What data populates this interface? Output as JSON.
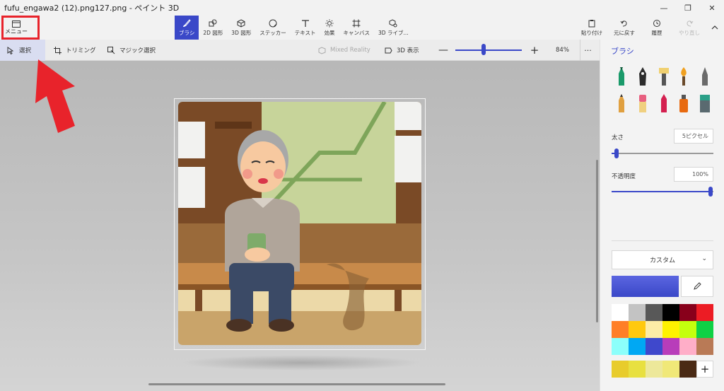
{
  "window": {
    "title": "fufu_engawa2 (12).png127.png - ペイント 3D",
    "minimize": "—",
    "maximize": "❐",
    "close": "✕"
  },
  "toolbar": {
    "menu_label": "メニュー",
    "tools": [
      {
        "label": "ブラシ",
        "icon": "brush-icon",
        "active": true
      },
      {
        "label": "2D 図形",
        "icon": "2d-shapes-icon",
        "active": false
      },
      {
        "label": "3D 図形",
        "icon": "3d-shapes-icon",
        "active": false
      },
      {
        "label": "ステッカー",
        "icon": "sticker-icon",
        "active": false
      },
      {
        "label": "テキスト",
        "icon": "text-icon",
        "active": false
      },
      {
        "label": "効果",
        "icon": "effects-icon",
        "active": false
      },
      {
        "label": "キャンバス",
        "icon": "canvas-icon",
        "active": false
      },
      {
        "label": "3D ライブ...",
        "icon": "3d-library-icon",
        "active": false
      }
    ],
    "right_tools": [
      {
        "label": "貼り付け",
        "icon": "paste-icon",
        "disabled": false
      },
      {
        "label": "元に戻す",
        "icon": "undo-icon",
        "disabled": false
      },
      {
        "label": "履歴",
        "icon": "history-icon",
        "disabled": false
      },
      {
        "label": "やり直し",
        "icon": "redo-icon",
        "disabled": true
      }
    ],
    "collapse_icon": "chevron-up-icon"
  },
  "subbar": {
    "select_label": "選択",
    "crop_label": "トリミング",
    "magic_select_label": "マジック選択",
    "mixed_reality_label": "Mixed Reality",
    "view3d_label": "3D 表示",
    "zoom_minus": "—",
    "zoom_plus": "+",
    "zoom_value": "84%",
    "more": "···",
    "zoom_level": 0.4
  },
  "panel": {
    "title": "ブラシ",
    "brushes": [
      {
        "name": "marker-brush-icon",
        "color": "#1a9a6a"
      },
      {
        "name": "calligraphy-pen-icon",
        "color": "#2c2c2c"
      },
      {
        "name": "oil-brush-icon",
        "color": "#e8b040"
      },
      {
        "name": "watercolor-brush-icon",
        "color": "#f0a020"
      },
      {
        "name": "pixel-pen-icon",
        "color": "#555555"
      },
      {
        "name": "pencil-icon",
        "color": "#e0a040"
      },
      {
        "name": "eraser-icon",
        "color": "#e86080"
      },
      {
        "name": "crayon-icon",
        "color": "#d42050"
      },
      {
        "name": "spray-can-icon",
        "color": "#e86a10"
      },
      {
        "name": "fill-bucket-icon",
        "color": "#2aa088"
      }
    ],
    "thickness_label": "太さ",
    "thickness_value": "5ピクセル",
    "thickness_level": 0.05,
    "opacity_label": "不透明度",
    "opacity_value": "100%",
    "opacity_level": 1.0,
    "dropdown_label": "カスタム",
    "dropdown_chevron": "⌄",
    "current_color": "#3a48c8",
    "palette": [
      "#ffffff",
      "#c3c3c3",
      "#585858",
      "#000000",
      "#88001b",
      "#ec1c24",
      "#ff7f27",
      "#ffc90e",
      "#fdeca6",
      "#fff200",
      "#c4ff0e",
      "#0ed145",
      "#8cfffb",
      "#00a8f3",
      "#3f48cc",
      "#b83dba",
      "#ffaec8",
      "#b97a56"
    ],
    "custom_colors": [
      "#e8cc2c",
      "#e8e040",
      "#ede89a",
      "#f0e878",
      "#4a2a14"
    ],
    "add_label": "+"
  },
  "overlay": {
    "highlight_color": "#e8232b"
  }
}
